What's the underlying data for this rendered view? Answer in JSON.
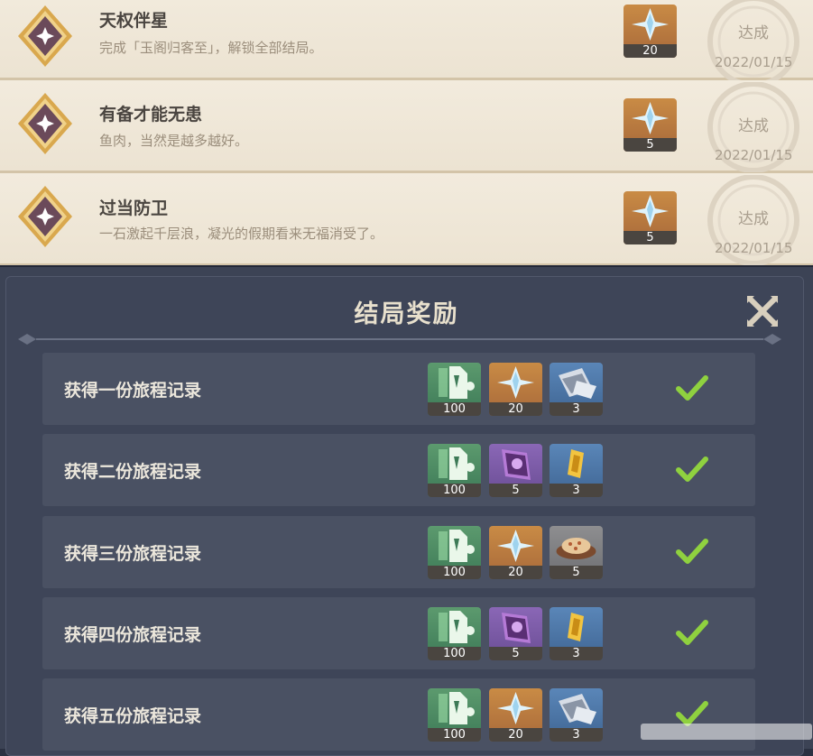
{
  "achievements": [
    {
      "title": "天权伴星",
      "desc": "完成「玉阁归客至」，解锁全部结局。",
      "reward_count": "20",
      "status": "达成",
      "date": "2022/01/15"
    },
    {
      "title": "有备才能无患",
      "desc": "鱼肉，当然是越多越好。",
      "reward_count": "5",
      "status": "达成",
      "date": "2022/01/15"
    },
    {
      "title": "过当防卫",
      "desc": "一石激起千层浪，凝光的假期看来无福消受了。",
      "reward_count": "5",
      "status": "达成",
      "date": "2022/01/15"
    }
  ],
  "dialog": {
    "title": "结局奖励",
    "rows": [
      {
        "label": "获得一份旅程记录",
        "items": [
          {
            "icon": "adventure-exp-icon",
            "color": "green",
            "count": "100"
          },
          {
            "icon": "primogem-icon",
            "color": "orange",
            "count": "20"
          },
          {
            "icon": "heros-wit-icon",
            "color": "blue",
            "count": "3"
          }
        ]
      },
      {
        "label": "获得二份旅程记录",
        "items": [
          {
            "icon": "adventure-exp-icon",
            "color": "green",
            "count": "100"
          },
          {
            "icon": "talent-book-icon",
            "color": "purple",
            "count": "5"
          },
          {
            "icon": "gold-ore-icon",
            "color": "blue",
            "count": "3"
          }
        ]
      },
      {
        "label": "获得三份旅程记录",
        "items": [
          {
            "icon": "adventure-exp-icon",
            "color": "green",
            "count": "100"
          },
          {
            "icon": "primogem-icon",
            "color": "orange",
            "count": "20"
          },
          {
            "icon": "dish-icon",
            "color": "grey",
            "count": "5"
          }
        ]
      },
      {
        "label": "获得四份旅程记录",
        "items": [
          {
            "icon": "adventure-exp-icon",
            "color": "green",
            "count": "100"
          },
          {
            "icon": "talent-book-icon",
            "color": "purple",
            "count": "5"
          },
          {
            "icon": "gold-ore-icon",
            "color": "blue",
            "count": "3"
          }
        ]
      },
      {
        "label": "获得五份旅程记录",
        "items": [
          {
            "icon": "adventure-exp-icon",
            "color": "green",
            "count": "100"
          },
          {
            "icon": "primogem-icon",
            "color": "orange",
            "count": "20"
          },
          {
            "icon": "heros-wit-icon",
            "color": "blue",
            "count": "3"
          }
        ]
      }
    ]
  }
}
